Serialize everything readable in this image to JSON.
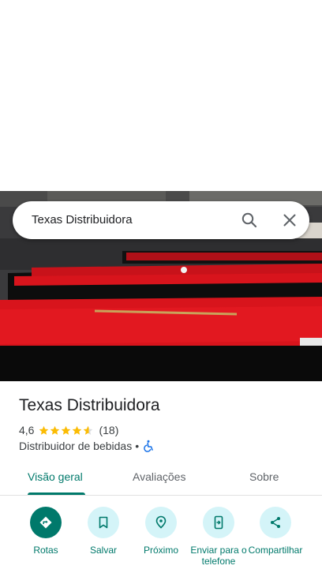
{
  "search": {
    "query": "Texas Distribuidora"
  },
  "place": {
    "name": "Texas Distribuidora",
    "rating": "4,6",
    "rating_fraction": 0.92,
    "reviews": "(18)",
    "category": "Distribuidor de bebidas",
    "separator": "•"
  },
  "tabs": [
    {
      "label": "Visão geral",
      "active": true
    },
    {
      "label": "Avaliações",
      "active": false
    },
    {
      "label": "Sobre",
      "active": false
    }
  ],
  "actions": [
    {
      "label": "Rotas",
      "icon": "directions-icon"
    },
    {
      "label": "Salvar",
      "icon": "bookmark-icon"
    },
    {
      "label": "Próximo",
      "icon": "nearby-icon"
    },
    {
      "label": "Enviar para o telefone",
      "icon": "send-to-phone-icon"
    },
    {
      "label": "Compartilhar",
      "icon": "share-icon"
    }
  ],
  "colors": {
    "accent": "#00796b",
    "action_bg": "#d4f4f8",
    "star": "#fbbc04",
    "table_felt": "#d8141c",
    "a11y": "#1a73e8"
  }
}
